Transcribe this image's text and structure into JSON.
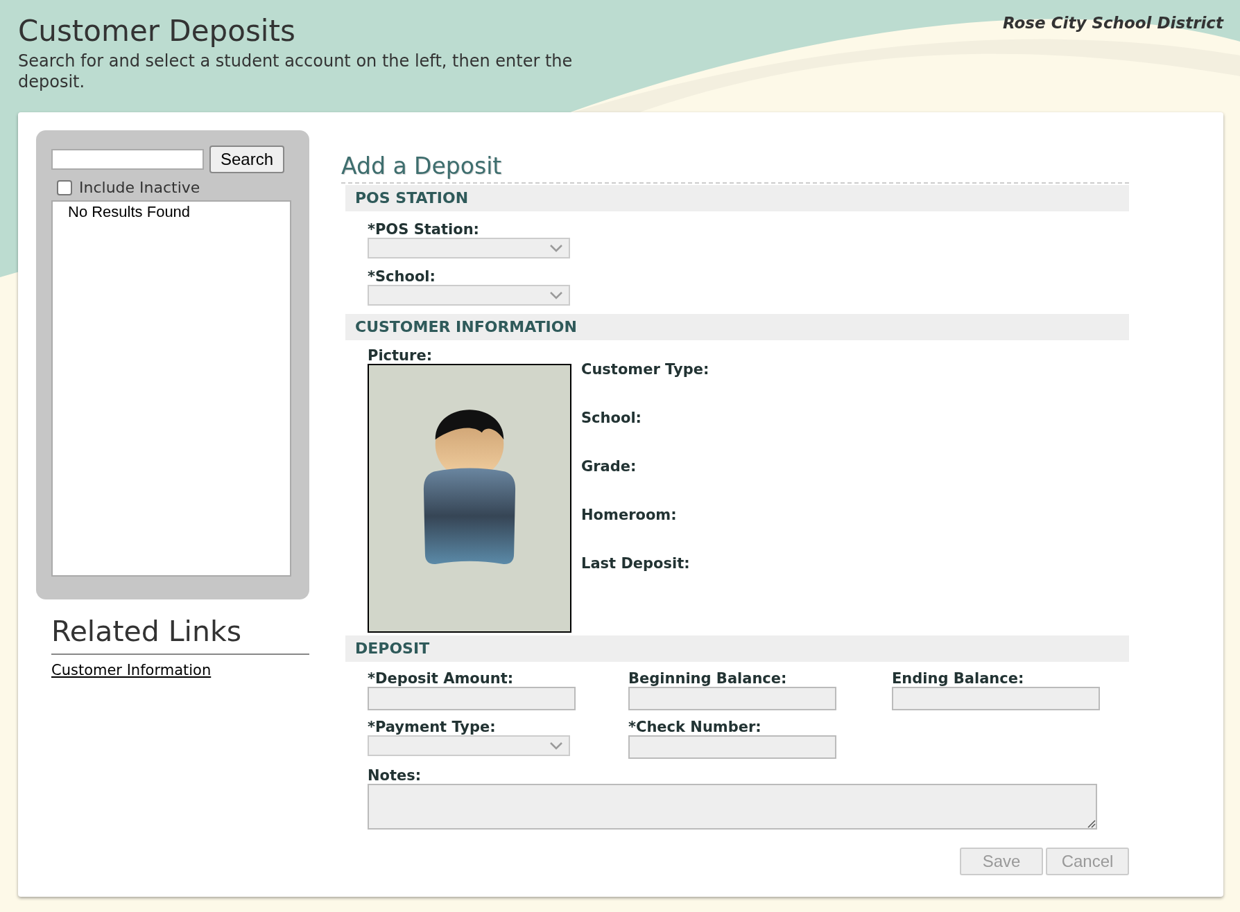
{
  "header": {
    "title": "Customer Deposits",
    "subtitle": "Search for and select a student account on the left, then enter the deposit.",
    "district": "Rose City School District"
  },
  "search_panel": {
    "search_button": "Search",
    "include_inactive": {
      "label": "Include Inactive",
      "checked": false
    },
    "results_message": "No Results Found"
  },
  "related_links": {
    "title": "Related Links",
    "links": [
      {
        "label": "Customer Information"
      }
    ]
  },
  "form": {
    "title": "Add a Deposit",
    "pos_station": {
      "title": "POS STATION",
      "fields": [
        {
          "kind": "select",
          "label": "*POS Station:",
          "disabled": true
        },
        {
          "kind": "select",
          "label": "*School:",
          "disabled": true
        }
      ]
    },
    "customer_information": {
      "title": "CUSTOMER INFORMATION",
      "picture_label": "Picture:",
      "details": [
        "Customer Type:",
        "School:",
        "Grade:",
        "Homeroom:",
        "Last Deposit:"
      ]
    },
    "deposit": {
      "title": "DEPOSIT",
      "fields": [
        {
          "kind": "text",
          "label": "*Deposit Amount:",
          "disabled": true
        },
        {
          "kind": "text",
          "label": "Beginning Balance:",
          "disabled": true
        },
        {
          "kind": "text",
          "label": "Ending Balance:",
          "disabled": true
        },
        {
          "kind": "select",
          "label": "*Payment Type:",
          "disabled": true
        },
        {
          "kind": "text",
          "label": "*Check Number:",
          "disabled": true
        },
        {
          "kind": "textarea",
          "label": "Notes:",
          "disabled": true
        }
      ]
    },
    "buttons": [
      {
        "label": "Save",
        "disabled": true
      },
      {
        "label": "Cancel",
        "disabled": true
      }
    ]
  }
}
